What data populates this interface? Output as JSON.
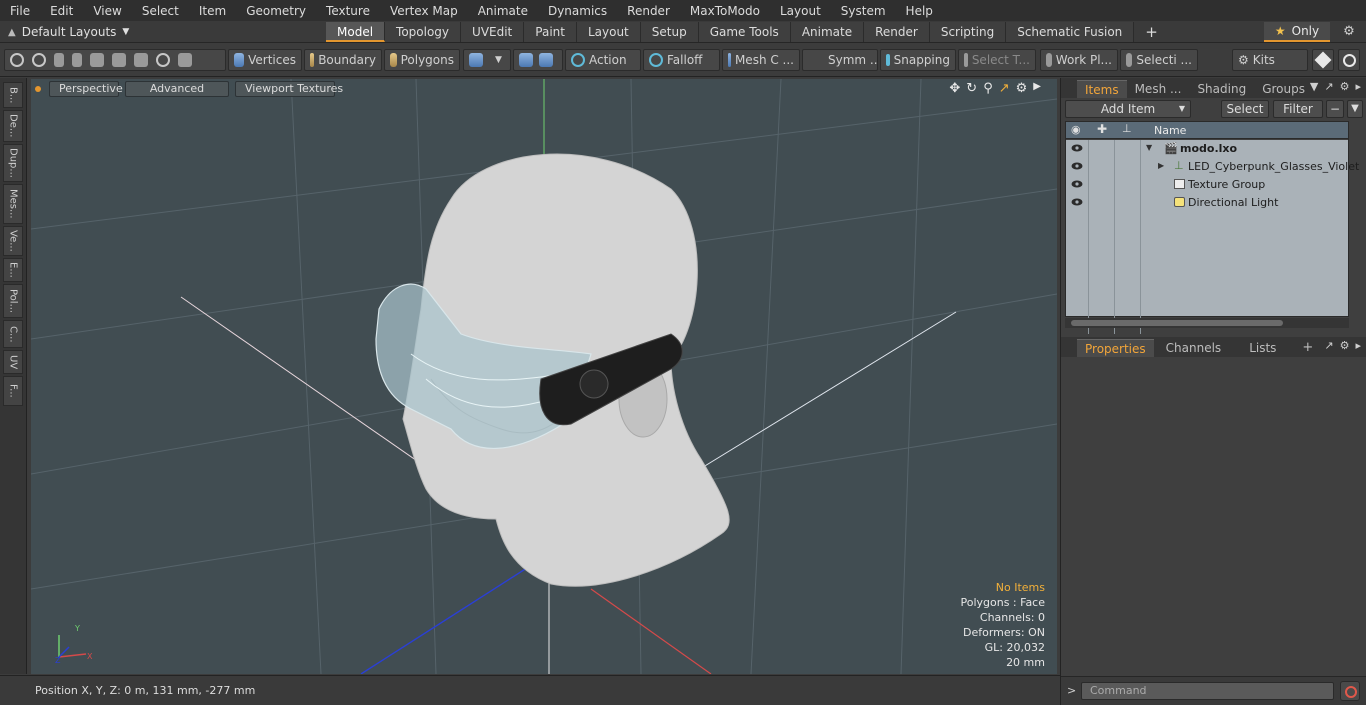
{
  "menu": [
    "File",
    "Edit",
    "View",
    "Select",
    "Item",
    "Geometry",
    "Texture",
    "Vertex Map",
    "Animate",
    "Dynamics",
    "Render",
    "MaxToModo",
    "Layout",
    "System",
    "Help"
  ],
  "layout": {
    "selector": "Default Layouts",
    "tabs": [
      "Model",
      "Topology",
      "UVEdit",
      "Paint",
      "Layout",
      "Setup",
      "Game Tools",
      "Animate",
      "Render",
      "Scripting",
      "Schematic Fusion"
    ],
    "active_tab": "Model",
    "only_label": "Only"
  },
  "toolbar": {
    "vertices": "Vertices",
    "boundary": "Boundary",
    "polygons": "Polygons",
    "action": "Action",
    "falloff": "Falloff",
    "mesh": "Mesh C ...",
    "symmetry": "Symm ...",
    "snapping": "Snapping",
    "select_t": "Select T...",
    "work_plane": "Work Pl...",
    "selection": "Selecti ...",
    "kits": "Kits"
  },
  "left_tabs": [
    "B...",
    "De...",
    "Dup...",
    "Mes...",
    "Ve...",
    "E...",
    "Pol...",
    "C...",
    "UV",
    "F..."
  ],
  "viewport": {
    "perspective": "Perspective",
    "advanced": "Advanced",
    "viewport_textures": "Viewport Textures",
    "info": {
      "no_items": "No Items",
      "polygons": "Polygons : Face",
      "channels": "Channels: 0",
      "deformers": "Deformers: ON",
      "gl": "GL: 20,032",
      "scale": "20 mm"
    },
    "axis": {
      "y": "Y",
      "z": "Z",
      "x": "X"
    }
  },
  "status": {
    "position": "Position X, Y, Z:   0 m, 131 mm, -277 mm"
  },
  "items_panel": {
    "tabs": [
      "Items",
      "Mesh ...",
      "Shading",
      "Groups"
    ],
    "active_tab": "Items",
    "add_item": "Add Item",
    "select": "Select",
    "filter": "Filter",
    "column_name": "Name",
    "tree": [
      {
        "label": "modo.lxo",
        "depth": 0,
        "bold": true
      },
      {
        "label": "LED_Cyberpunk_Glasses_Violet",
        "depth": 1,
        "bold": false
      },
      {
        "label": "Texture Group",
        "depth": 1,
        "bold": false
      },
      {
        "label": "Directional Light",
        "depth": 1,
        "bold": false
      }
    ]
  },
  "properties_panel": {
    "tabs": [
      "Properties",
      "Channels",
      "Lists"
    ],
    "active_tab": "Properties"
  },
  "command": {
    "placeholder": "Command",
    "prompt": ">"
  },
  "colors": {
    "accent": "#e3962f",
    "viewport_bg": "#414d52",
    "tree_bg": "#aab2b8"
  }
}
